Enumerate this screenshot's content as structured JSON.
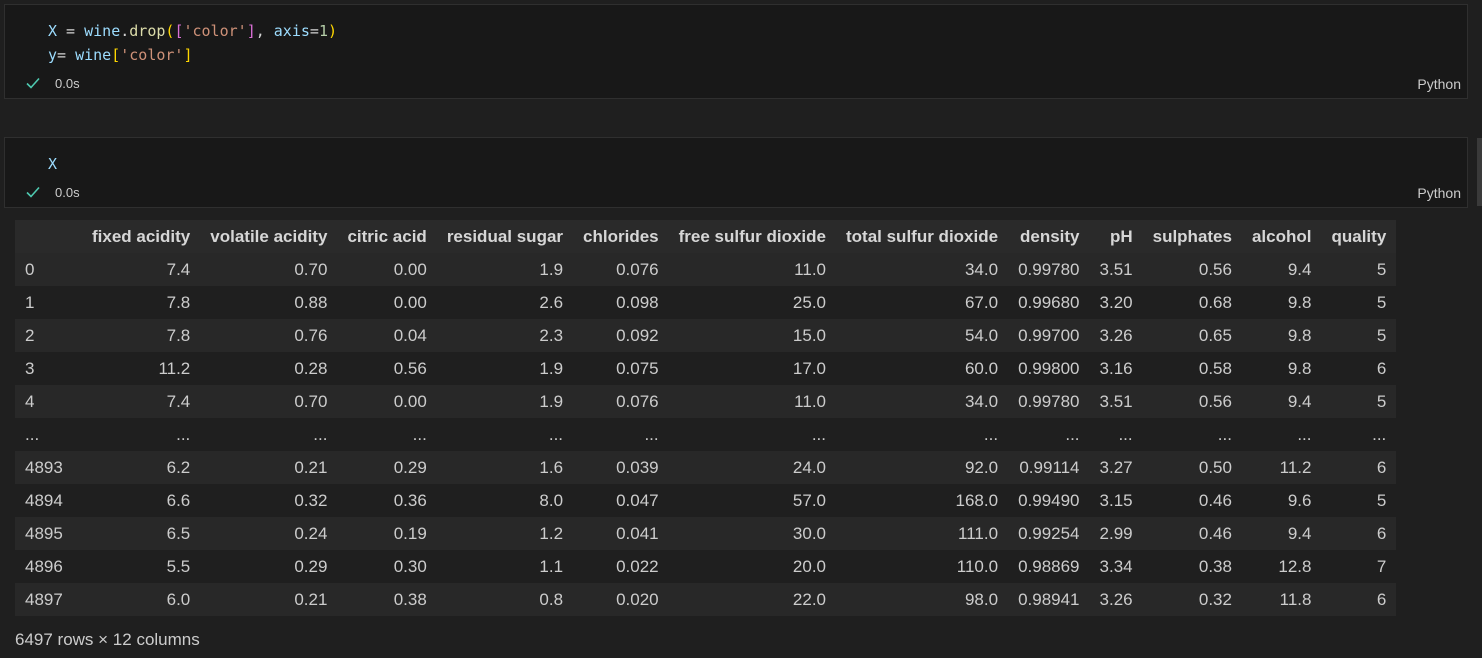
{
  "cells": [
    {
      "code_lines": [
        [
          {
            "t": "X",
            "c": "var"
          },
          {
            "t": " = ",
            "c": "op"
          },
          {
            "t": "wine",
            "c": "var"
          },
          {
            "t": ".",
            "c": "op"
          },
          {
            "t": "drop",
            "c": "fn"
          },
          {
            "t": "(",
            "c": "br1"
          },
          {
            "t": "[",
            "c": "br2"
          },
          {
            "t": "'color'",
            "c": "str"
          },
          {
            "t": "]",
            "c": "br2"
          },
          {
            "t": ", ",
            "c": "op"
          },
          {
            "t": "axis",
            "c": "kw"
          },
          {
            "t": "=",
            "c": "op"
          },
          {
            "t": "1",
            "c": "num"
          },
          {
            "t": ")",
            "c": "br1"
          }
        ],
        [
          {
            "t": "y",
            "c": "var"
          },
          {
            "t": "= ",
            "c": "op"
          },
          {
            "t": "wine",
            "c": "var"
          },
          {
            "t": "[",
            "c": "br1"
          },
          {
            "t": "'color'",
            "c": "str"
          },
          {
            "t": "]",
            "c": "br1"
          }
        ]
      ],
      "exec_time": "0.0s",
      "language": "Python"
    },
    {
      "code_lines": [
        [
          {
            "t": "X",
            "c": "var"
          }
        ]
      ],
      "exec_time": "0.0s",
      "language": "Python"
    }
  ],
  "status_icon": "check-icon",
  "colors": {
    "check": "#4ec9b0",
    "background": "#1f1f1f",
    "cell_background": "#181818"
  },
  "table": {
    "columns": [
      "",
      "fixed acidity",
      "volatile acidity",
      "citric acid",
      "residual sugar",
      "chlorides",
      "free sulfur dioxide",
      "total sulfur dioxide",
      "density",
      "pH",
      "sulphates",
      "alcohol",
      "quality"
    ],
    "rows": [
      [
        "0",
        "7.4",
        "0.70",
        "0.00",
        "1.9",
        "0.076",
        "11.0",
        "34.0",
        "0.99780",
        "3.51",
        "0.56",
        "9.4",
        "5"
      ],
      [
        "1",
        "7.8",
        "0.88",
        "0.00",
        "2.6",
        "0.098",
        "25.0",
        "67.0",
        "0.99680",
        "3.20",
        "0.68",
        "9.8",
        "5"
      ],
      [
        "2",
        "7.8",
        "0.76",
        "0.04",
        "2.3",
        "0.092",
        "15.0",
        "54.0",
        "0.99700",
        "3.26",
        "0.65",
        "9.8",
        "5"
      ],
      [
        "3",
        "11.2",
        "0.28",
        "0.56",
        "1.9",
        "0.075",
        "17.0",
        "60.0",
        "0.99800",
        "3.16",
        "0.58",
        "9.8",
        "6"
      ],
      [
        "4",
        "7.4",
        "0.70",
        "0.00",
        "1.9",
        "0.076",
        "11.0",
        "34.0",
        "0.99780",
        "3.51",
        "0.56",
        "9.4",
        "5"
      ],
      [
        "...",
        "...",
        "...",
        "...",
        "...",
        "...",
        "...",
        "...",
        "...",
        "...",
        "...",
        "...",
        "..."
      ],
      [
        "4893",
        "6.2",
        "0.21",
        "0.29",
        "1.6",
        "0.039",
        "24.0",
        "92.0",
        "0.99114",
        "3.27",
        "0.50",
        "11.2",
        "6"
      ],
      [
        "4894",
        "6.6",
        "0.32",
        "0.36",
        "8.0",
        "0.047",
        "57.0",
        "168.0",
        "0.99490",
        "3.15",
        "0.46",
        "9.6",
        "5"
      ],
      [
        "4895",
        "6.5",
        "0.24",
        "0.19",
        "1.2",
        "0.041",
        "30.0",
        "111.0",
        "0.99254",
        "2.99",
        "0.46",
        "9.4",
        "6"
      ],
      [
        "4896",
        "5.5",
        "0.29",
        "0.30",
        "1.1",
        "0.022",
        "20.0",
        "110.0",
        "0.98869",
        "3.34",
        "0.38",
        "12.8",
        "7"
      ],
      [
        "4897",
        "6.0",
        "0.21",
        "0.38",
        "0.8",
        "0.020",
        "22.0",
        "98.0",
        "0.98941",
        "3.26",
        "0.32",
        "11.8",
        "6"
      ]
    ],
    "shape_text": "6497 rows × 12 columns"
  }
}
